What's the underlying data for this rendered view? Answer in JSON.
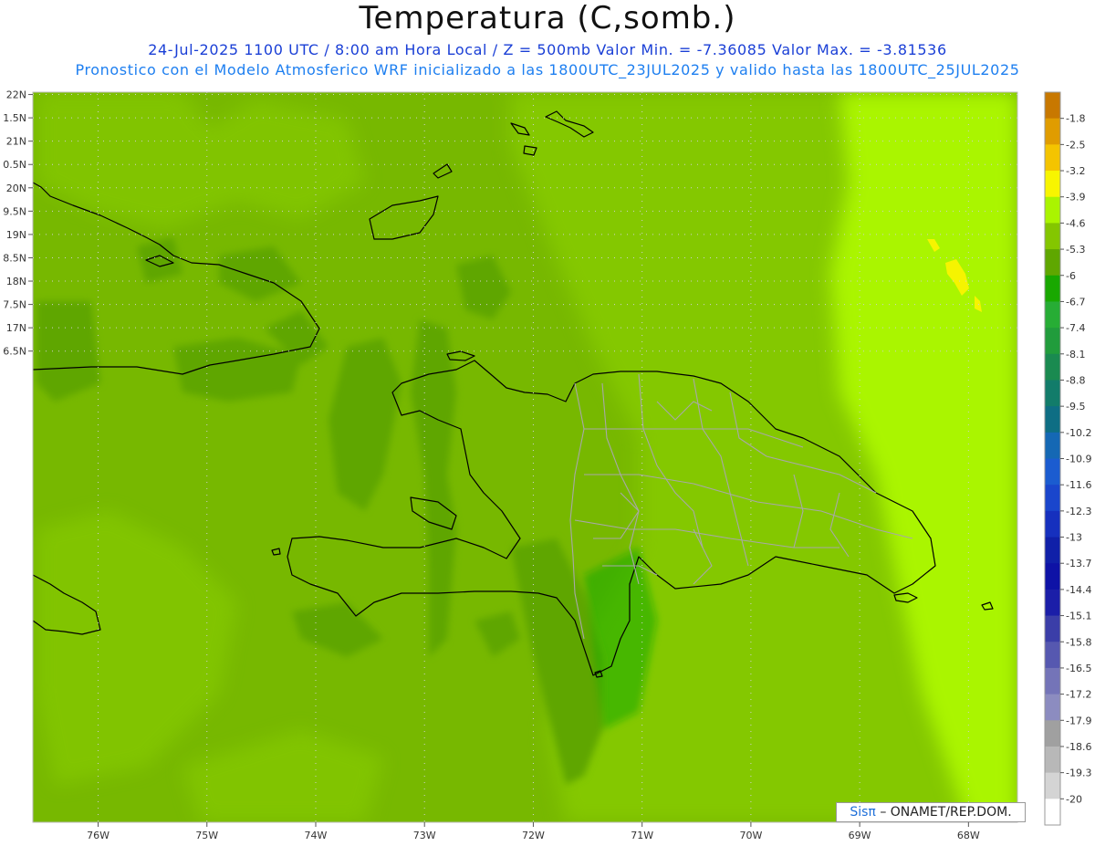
{
  "title": "Temperatura (C,somb.)",
  "subtitle_line1": "24-Jul-2025   1100 UTC / 8:00 am Hora Local / Z = 500mb  Valor Min. = -7.36085  Valor Max. = -3.81536",
  "subtitle_line2": "Pronostico con el Modelo Atmosferico WRF inicializado a las 1800UTC_23JUL2025 y valido hasta las  1800UTC_25JUL2025",
  "map": {
    "lat_range": [
      6.4,
      22.05
    ],
    "lon_range": [
      -76.6,
      -67.55
    ],
    "lat_labels": [
      {
        "lat": 22.0,
        "text": "22N"
      },
      {
        "lat": 21.5,
        "text": "1.5N"
      },
      {
        "lat": 21.0,
        "text": "21N"
      },
      {
        "lat": 20.5,
        "text": "0.5N"
      },
      {
        "lat": 20.0,
        "text": "20N"
      },
      {
        "lat": 19.5,
        "text": "9.5N"
      },
      {
        "lat": 19.0,
        "text": "19N"
      },
      {
        "lat": 18.5,
        "text": "8.5N"
      },
      {
        "lat": 18.0,
        "text": "18N"
      },
      {
        "lat": 17.5,
        "text": "7.5N"
      },
      {
        "lat": 17.0,
        "text": "17N"
      },
      {
        "lat": 16.5,
        "text": "6.5N"
      }
    ],
    "lon_labels": [
      {
        "lon": -76,
        "text": "76W"
      },
      {
        "lon": -75,
        "text": "75W"
      },
      {
        "lon": -74,
        "text": "74W"
      },
      {
        "lon": -73,
        "text": "73W"
      },
      {
        "lon": -72,
        "text": "72W"
      },
      {
        "lon": -71,
        "text": "71W"
      },
      {
        "lon": -70,
        "text": "70W"
      },
      {
        "lon": -69,
        "text": "69W"
      },
      {
        "lon": -68,
        "text": "68W"
      }
    ],
    "background_color": "#77b800",
    "shading": [
      {
        "level": -6,
        "color": "#5ea600"
      },
      {
        "level": -5.3,
        "color": "#84c800"
      },
      {
        "level": -4.6,
        "color": "#aaf500"
      },
      {
        "level": -3.9,
        "color": "#f6f400"
      }
    ]
  },
  "colorbar": {
    "levels": [
      "-1.8",
      "-2.5",
      "-3.2",
      "-3.9",
      "-4.6",
      "-5.3",
      "-6",
      "-6.7",
      "-7.4",
      "-8.1",
      "-8.8",
      "-9.5",
      "-10.2",
      "-10.9",
      "-11.6",
      "-12.3",
      "-13",
      "-13.7",
      "-14.4",
      "-15.1",
      "-15.8",
      "-16.5",
      "-17.2",
      "-17.9",
      "-18.6",
      "-19.3",
      "-20"
    ],
    "colors": [
      "#c87800",
      "#e09c00",
      "#f4c400",
      "#f8f500",
      "#aaf400",
      "#84c600",
      "#5fa700",
      "#19a800",
      "#27ad35",
      "#219c3c",
      "#1a8a50",
      "#127c6a",
      "#0e6e84",
      "#1568b4",
      "#1b5cd0",
      "#1a46cc",
      "#1630be",
      "#1020a8",
      "#0e12a6",
      "#1b1ea8",
      "#3b3ea8",
      "#5658b0",
      "#7474b8",
      "#8c8cc0",
      "#a0a0a0",
      "#b8b8b8",
      "#d4d4d4",
      "#ffffff"
    ]
  },
  "brand": {
    "sis": "Sisπ",
    "rest": "– ONAMET/REP.DOM."
  }
}
